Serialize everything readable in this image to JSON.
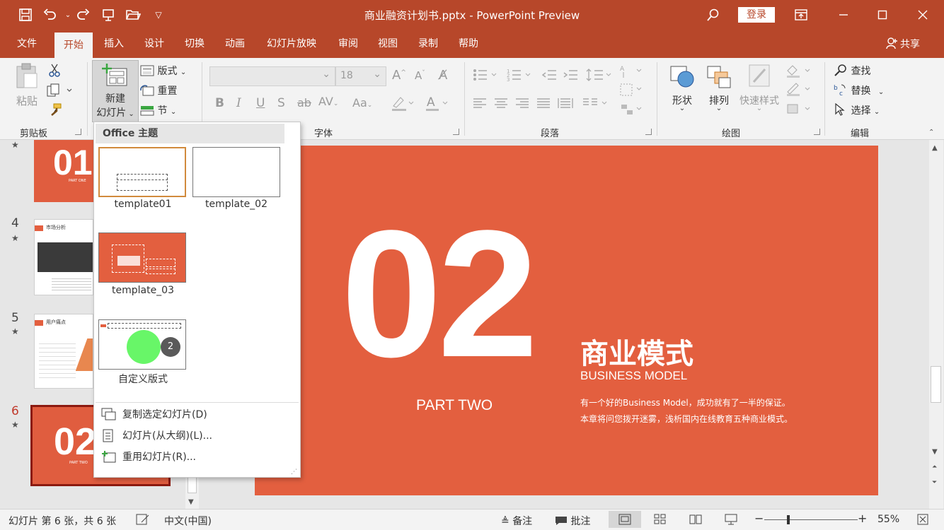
{
  "titlebar": {
    "doc_title": "商业融资计划书.pptx  -  PowerPoint Preview",
    "signin": "登录",
    "icons": [
      "save-icon",
      "undo-icon",
      "redo-icon",
      "present-icon",
      "open-icon",
      "customize-icon",
      "search-icon",
      "ribbon-display-icon",
      "minimize-icon",
      "maximize-icon",
      "close-icon"
    ]
  },
  "tabs": [
    {
      "label": "文件"
    },
    {
      "label": "开始"
    },
    {
      "label": "插入"
    },
    {
      "label": "设计"
    },
    {
      "label": "切换"
    },
    {
      "label": "动画"
    },
    {
      "label": "幻灯片放映"
    },
    {
      "label": "审阅"
    },
    {
      "label": "视图"
    },
    {
      "label": "录制"
    },
    {
      "label": "帮助"
    }
  ],
  "share": "共享",
  "ribbon": {
    "clipboard": {
      "paste": "粘贴",
      "group": "剪贴板"
    },
    "slides": {
      "new_line1": "新建",
      "new_line2": "幻灯片",
      "layout": "版式",
      "reset": "重置",
      "section": "节"
    },
    "font": {
      "size": "18",
      "group": "字体"
    },
    "paragraph": {
      "group": "段落"
    },
    "drawing": {
      "shapes": "形状",
      "arrange": "排列",
      "quick_styles": "快速样式",
      "group": "绘图"
    },
    "editing": {
      "find": "查找",
      "replace": "替换",
      "select": "选择",
      "group": "编辑"
    }
  },
  "thumbnails": [
    {
      "num": "",
      "big": "01",
      "sub": "PART ONE"
    },
    {
      "num": "4",
      "title": "市场分析"
    },
    {
      "num": "5",
      "title": "用户痛点"
    },
    {
      "num": "6",
      "big": "02",
      "sub": "PART TWO"
    }
  ],
  "slide": {
    "number": "02",
    "part": "PART TWO",
    "title": "商业模式",
    "subtitle": "BUSINESS MODEL",
    "desc1": "有一个好的Business Model，成功就有了一半的保证。",
    "desc2": "本章将问您拨开迷雾，浅析国内在线教育五种商业模式。"
  },
  "dropdown": {
    "header": "Office 主题",
    "layouts": [
      {
        "label": "template01"
      },
      {
        "label": "template_02"
      },
      {
        "label": "template_03"
      },
      {
        "label": "自定义版式",
        "badge": "2"
      }
    ],
    "menu": [
      {
        "label": "复制选定幻灯片(D)"
      },
      {
        "label": "幻灯片(从大纲)(L)..."
      },
      {
        "label": "重用幻灯片(R)..."
      }
    ]
  },
  "status": {
    "slide_info": "幻灯片 第 6 张，共 6 张",
    "language": "中文(中国)",
    "notes": "备注",
    "comments": "批注",
    "zoom": "55%"
  },
  "colors": {
    "brand": "#b7472a",
    "slide_bg": "#e35f3f"
  }
}
